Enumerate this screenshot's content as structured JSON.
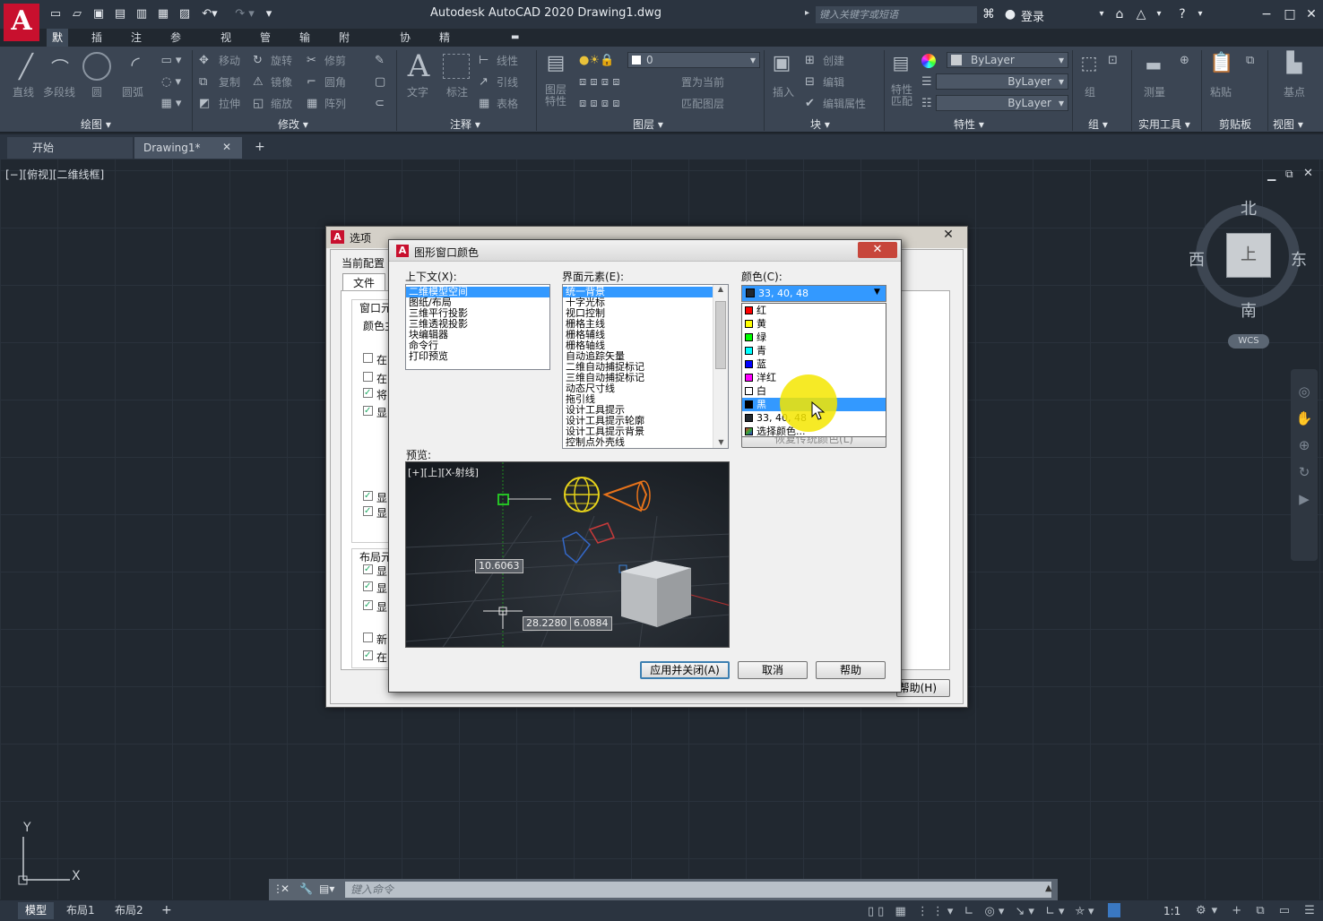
{
  "app": {
    "logo_letter": "A",
    "title": "Autodesk AutoCAD 2020    Drawing1.dwg",
    "search_placeholder": "键入关键字或短语",
    "login": "登录"
  },
  "ribbon_tabs": [
    "默认",
    "插入",
    "注释",
    "参数化",
    "视图",
    "管理",
    "输出",
    "附加模块",
    "协作",
    "精选应用"
  ],
  "ribbon": {
    "draw": {
      "label": "绘图 ▾",
      "tools": [
        "直线",
        "多段线",
        "圆",
        "圆弧"
      ]
    },
    "modify": {
      "label": "修改 ▾",
      "tools": [
        "移动",
        "旋转",
        "修剪",
        "复制",
        "镜像",
        "圆角",
        "拉伸",
        "缩放",
        "阵列"
      ]
    },
    "annotation": {
      "label": "注释 ▾",
      "tools": [
        "文字",
        "标注",
        "线性",
        "引线",
        "表格"
      ]
    },
    "layers": {
      "label": "图层 ▾",
      "layer_value": "0",
      "tools": [
        "图层特性",
        "置为当前",
        "匹配图层"
      ]
    },
    "block": {
      "label": "块 ▾",
      "tools": [
        "插入",
        "创建",
        "编辑",
        "编辑属性"
      ]
    },
    "properties": {
      "label": "特性 ▾",
      "bylayer": "ByLayer",
      "tools": [
        "特性匹配"
      ]
    },
    "group": {
      "label": "组 ▾",
      "tool": "组"
    },
    "utilities": {
      "label": "实用工具 ▾",
      "tool": "测量"
    },
    "clipboard": {
      "label": "剪贴板",
      "tool": "粘贴"
    },
    "view": {
      "label": "视图 ▾",
      "tool": "基点"
    }
  },
  "doc_tabs": [
    "开始",
    "Drawing1*"
  ],
  "viewport_label": "[−][俯视][二维线框]",
  "viewcube": {
    "north": "北",
    "south": "南",
    "east": "东",
    "west": "西",
    "face": "上",
    "wcs": "WCS"
  },
  "ucs": {
    "x": "X",
    "y": "Y"
  },
  "command_placeholder": "键入命令",
  "layout_tabs": [
    "模型",
    "布局1",
    "布局2"
  ],
  "status": {
    "scale": "1:1"
  },
  "options_dialog": {
    "title": "选项",
    "current_profile": "当前配置",
    "tab_file": "文件",
    "section1": "窗口元",
    "color_label": "颜色主",
    "section2": "布局元",
    "left_items": [
      "在",
      "在",
      "将",
      "显",
      "显",
      "显",
      "显",
      "显",
      "显",
      "新",
      "在"
    ],
    "help": "帮助(H)"
  },
  "gwc_dialog": {
    "title": "图形窗口颜色",
    "context_label": "上下文(X):",
    "contexts": [
      "二维模型空间",
      "图纸/布局",
      "三维平行投影",
      "三维透视投影",
      "块编辑器",
      "命令行",
      "打印预览"
    ],
    "element_label": "界面元素(E):",
    "elements": [
      "统一背景",
      "十字光标",
      "视口控制",
      "栅格主线",
      "栅格辅线",
      "栅格轴线",
      "自动追踪矢量",
      "二维自动捕捉标记",
      "三维自动捕捉标记",
      "动态尺寸线",
      "拖引线",
      "设计工具提示",
      "设计工具提示轮廓",
      "设计工具提示背景",
      "控制点外壳线"
    ],
    "color_label": "颜色(C):",
    "color_value": "33, 40, 48",
    "color_options": [
      {
        "name": "红",
        "hex": "#ff0000"
      },
      {
        "name": "黄",
        "hex": "#ffff00"
      },
      {
        "name": "绿",
        "hex": "#00ff00"
      },
      {
        "name": "青",
        "hex": "#00ffff"
      },
      {
        "name": "蓝",
        "hex": "#0000ff"
      },
      {
        "name": "洋红",
        "hex": "#ff00ff"
      },
      {
        "name": "白",
        "hex": "#ffffff"
      },
      {
        "name": "黑",
        "hex": "#000000"
      },
      {
        "name": "33, 40, 48",
        "hex": "#21282f"
      },
      {
        "name": "选择颜色...",
        "hex": "#6b5fa8"
      }
    ],
    "restore_button": "恢复传统颜色(L)",
    "preview_label": "预览:",
    "preview_viewport": "[+][上][X-射线]",
    "dims": [
      "10.6063",
      "28.2280",
      "6.0884"
    ],
    "buttons": {
      "apply": "应用并关闭(A)",
      "cancel": "取消",
      "help": "帮助"
    }
  }
}
